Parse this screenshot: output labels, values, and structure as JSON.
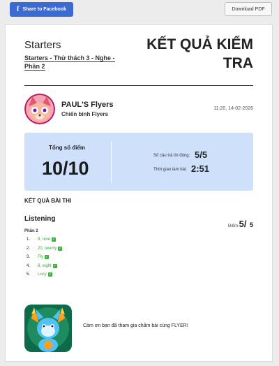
{
  "toolbar": {
    "share_label": "Share to Facebook",
    "share_icon": "facebook-icon",
    "download_label": "Download PDF"
  },
  "header": {
    "course_title": "Starters",
    "course_subtitle": "Starters - Thử thách 3 - Nghe - Phần 2",
    "result_title": "KẾT QUẢ KIỂM TRA"
  },
  "user": {
    "name": "PAUL'S Flyers",
    "role": "Chiến binh Flyers",
    "timestamp": "11:20, 14-02-2026"
  },
  "score": {
    "total_label": "Tổng số điểm",
    "total_value": "10/10",
    "correct_label": "Số câu trả lời đúng:",
    "correct_value": "5/5",
    "time_label": "Thời gian làm bài:",
    "time_value": "2:51"
  },
  "results": {
    "section_title": "KẾT QUẢ BÀI THI",
    "listening_title": "Listening",
    "points_label": "Điểm:",
    "points_value": "5",
    "points_separator": "/",
    "points_max": "5",
    "part_label": "Phần 2",
    "answers": [
      {
        "num": "1.",
        "text": "9, nine"
      },
      {
        "num": "2.",
        "text": "20, twenty"
      },
      {
        "num": "3.",
        "text": "Fly"
      },
      {
        "num": "4.",
        "text": "8, eight"
      },
      {
        "num": "5.",
        "text": "Lucy"
      }
    ]
  },
  "footer": {
    "thanks": "Cảm ơn bạn đã tham gia chấm bài cùng FLYER!"
  },
  "colors": {
    "facebook_blue": "#3b6ad3",
    "score_box_bg": "#cfe0fb",
    "answer_green": "#3fa33a",
    "check_green": "#38b33a"
  }
}
